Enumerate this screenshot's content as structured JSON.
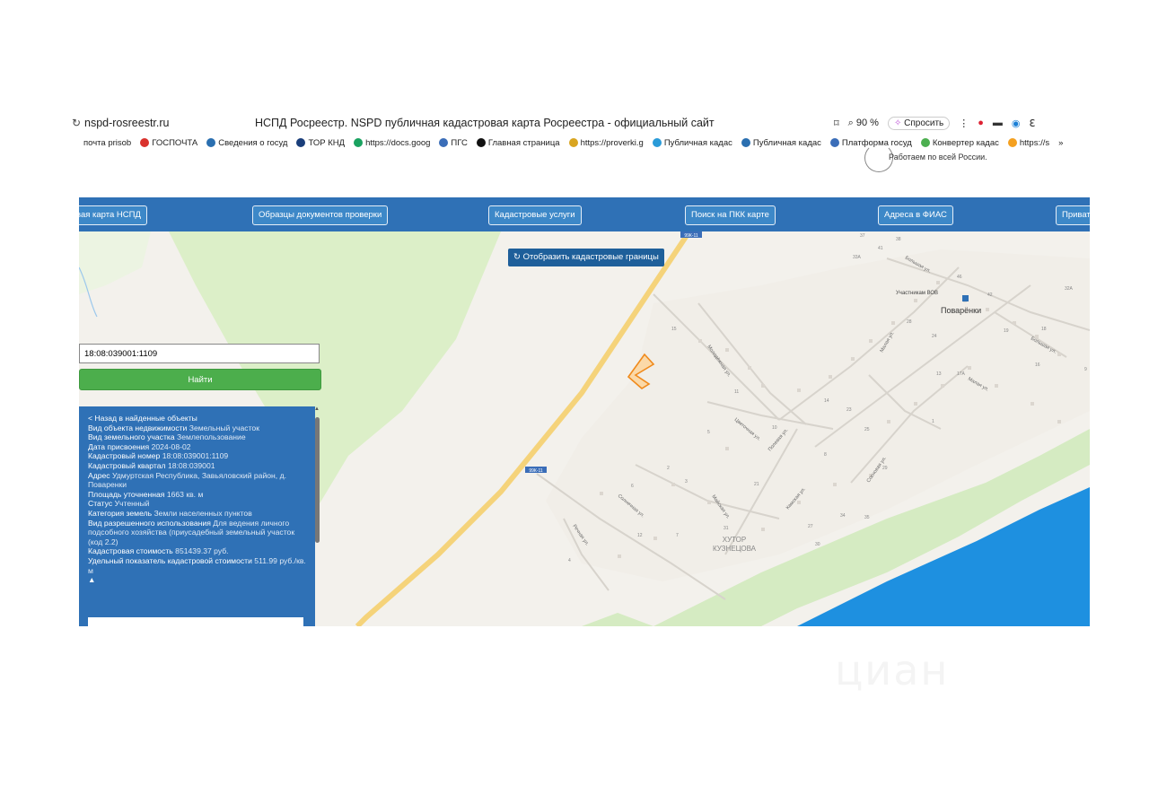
{
  "browser": {
    "url": "nspd-rosreestr.ru",
    "title": "НСПД Росреестр. NSPD публичная кадастровая карта Росреестра - официальный сайт",
    "zoom": "90 %",
    "ask": "Спросить"
  },
  "bookmarks": [
    {
      "label": "почта prisob",
      "color": "#ffffff"
    },
    {
      "label": "ГОСПОЧТА",
      "color": "#d9322d"
    },
    {
      "label": "Сведения о госуд",
      "color": "#2a6fb0"
    },
    {
      "label": "ТОР КНД",
      "color": "#1a3e7a"
    },
    {
      "label": "https://docs.goog",
      "color": "#1aa260"
    },
    {
      "label": "ПГС",
      "color": "#3a6db8"
    },
    {
      "label": "Главная страница",
      "color": "#111111"
    },
    {
      "label": "https://proverki.g",
      "color": "#d9a520"
    },
    {
      "label": "Публичная кадас",
      "color": "#2a9bd8"
    },
    {
      "label": "Публичная кадас",
      "color": "#2a6fb0"
    },
    {
      "label": "Платформа госуд",
      "color": "#3a6db8"
    },
    {
      "label": "Конвертер кадас",
      "color": "#4caf50"
    },
    {
      "label": "https://s",
      "color": "#f4a020"
    }
  ],
  "bookmarks_more": "»",
  "promo": "Работаем по всей России.",
  "nav": {
    "items": [
      "вая карта НСПД",
      "Образцы документов проверки",
      "Кадастровые услуги",
      "Поиск на ПКК карте",
      "Адреса в ФИАС",
      "Приват"
    ]
  },
  "map": {
    "show_boundaries": "Отобразить кадастровые границы",
    "road_badge_1": "99К-11",
    "road_badge_2": "99К-11",
    "village": "Поварёнки",
    "khutor_line1": "ХУТОР",
    "khutor_line2": "КУЗНЕЦОВА",
    "landmark": "Участникам ВОВ",
    "streets": [
      "Большая ул.",
      "Молодёжная ул.",
      "Цветочная ул.",
      "Полевая ул.",
      "Малая ул.",
      "Солнечная ул.",
      "Речная ул.",
      "Майская ул.",
      "Камская ул.",
      "Сосновая ул.",
      "Большая ул.",
      "Малая ул."
    ],
    "house_numbers": [
      "37",
      "41",
      "38",
      "33А",
      "46",
      "42",
      "32А",
      "28",
      "24",
      "19",
      "18",
      "15",
      "13",
      "12",
      "17А",
      "16",
      "10",
      "11",
      "14",
      "9",
      "4",
      "1",
      "2",
      "3",
      "5",
      "6",
      "7",
      "8",
      "21",
      "23",
      "25",
      "27",
      "29",
      "30",
      "31",
      "34",
      "35"
    ]
  },
  "search": {
    "value": "18:08:039001:1109",
    "button": "Найти"
  },
  "info": {
    "back": "< Назад в найденные объекты",
    "rows": [
      {
        "label": "Вид объекта недвижимости",
        "value": "Земельный участок"
      },
      {
        "label": "Вид земельного участка",
        "value": "Землепользование"
      },
      {
        "label": "Дата присвоения",
        "value": "2024-08-02"
      },
      {
        "label": "Кадастровый номер",
        "value": "18:08:039001:1109"
      },
      {
        "label": "Кадастровый квартал",
        "value": "18:08:039001"
      },
      {
        "label": "Адрес",
        "value": "Удмуртская Республика, Завьяловский район, д. Поваренки"
      },
      {
        "label": "Площадь уточненная",
        "value": "1663 кв. м"
      },
      {
        "label": "Статус",
        "value": "Учтенный"
      },
      {
        "label": "Категория земель",
        "value": "Земли населенных пунктов"
      },
      {
        "label": "Вид разрешенного использования",
        "value": "Для ведения личного подсобного хозяйства (приусадебный земельный участок (код 2.2)"
      },
      {
        "label": "Кадастровая стоимость",
        "value": "851439.37 руб."
      },
      {
        "label": "Удельный показатель кадастровой стоимости",
        "value": "511.99 руб./кв. м"
      }
    ],
    "collapse": "▲"
  },
  "watermark": "циан",
  "colors": {
    "nav": "#2f71b6",
    "find": "#4cae4c",
    "water": "#1e90e0",
    "forest": "#dcefc8",
    "road": "#f5d37a",
    "parcel": "#f08a1c"
  }
}
